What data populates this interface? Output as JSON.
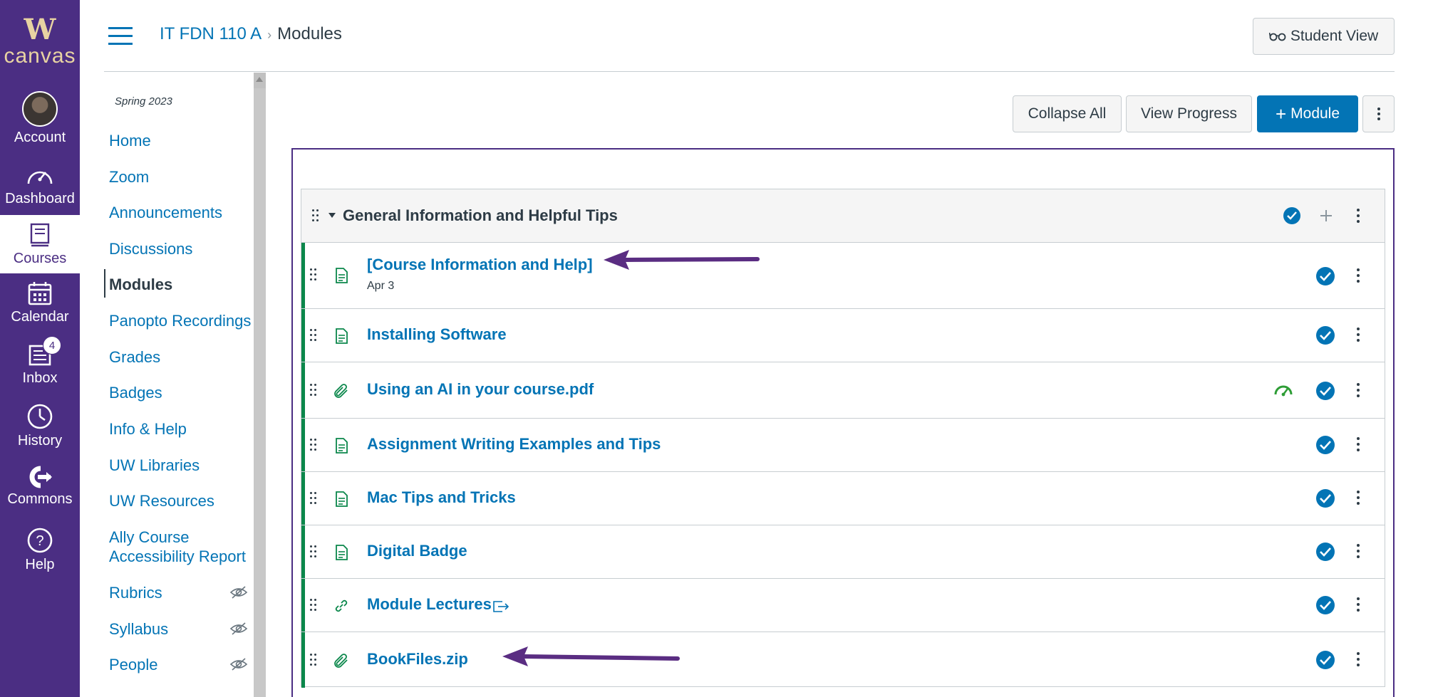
{
  "brand": {
    "letter": "W",
    "name": "canvas"
  },
  "global_nav": [
    {
      "id": "account",
      "label": "Account",
      "icon": "avatar"
    },
    {
      "id": "dashboard",
      "label": "Dashboard",
      "icon": "dashboard-icon"
    },
    {
      "id": "courses",
      "label": "Courses",
      "icon": "courses-icon",
      "active": true
    },
    {
      "id": "calendar",
      "label": "Calendar",
      "icon": "calendar-icon"
    },
    {
      "id": "inbox",
      "label": "Inbox",
      "icon": "inbox-icon",
      "badge": "4"
    },
    {
      "id": "history",
      "label": "History",
      "icon": "clock-icon"
    },
    {
      "id": "commons",
      "label": "Commons",
      "icon": "commons-icon"
    },
    {
      "id": "help",
      "label": "Help",
      "icon": "help-icon"
    }
  ],
  "header": {
    "course": "IT FDN 110 A",
    "separator": "›",
    "page": "Modules",
    "student_view": "Student View"
  },
  "course_nav": {
    "term": "Spring 2023",
    "items": [
      {
        "label": "Home"
      },
      {
        "label": "Zoom"
      },
      {
        "label": "Announcements"
      },
      {
        "label": "Discussions"
      },
      {
        "label": "Modules",
        "active": true
      },
      {
        "label": "Panopto Recordings"
      },
      {
        "label": "Grades"
      },
      {
        "label": "Badges"
      },
      {
        "label": "Info & Help"
      },
      {
        "label": "UW Libraries"
      },
      {
        "label": "UW Resources"
      },
      {
        "label": "Ally Course",
        "label2": "Accessibility Report"
      },
      {
        "label": "Rubrics",
        "hidden": true
      },
      {
        "label": "Syllabus",
        "hidden": true
      },
      {
        "label": "People",
        "hidden": true
      }
    ]
  },
  "toolbar": {
    "collapse_all": "Collapse All",
    "view_progress": "View Progress",
    "add_module": "Module",
    "add_module_prefix": "+"
  },
  "module": {
    "title": "General Information and Helpful Tips",
    "items": [
      {
        "title": "[Course Information and Help]",
        "type": "page",
        "date": "Apr 3",
        "published": true
      },
      {
        "title": "Installing Software",
        "type": "page",
        "published": true
      },
      {
        "title": "Using an AI in your course.pdf",
        "type": "file",
        "published": true,
        "ally_indicator": true
      },
      {
        "title": "Assignment Writing Examples and Tips",
        "type": "page",
        "published": true
      },
      {
        "title": "Mac Tips and Tricks",
        "type": "page",
        "published": true
      },
      {
        "title": "Digital Badge",
        "type": "page",
        "published": true
      },
      {
        "title": "Module Lectures",
        "type": "link",
        "published": true,
        "external": true
      },
      {
        "title": "BookFiles.zip",
        "type": "file",
        "published": true
      }
    ]
  },
  "colors": {
    "nav_purple": "#4b2e83",
    "brand_gold": "#e8d3a2",
    "link_blue": "#0374b5",
    "published_green": "#0b874b",
    "annotation_arrow": "#5a2d82"
  }
}
